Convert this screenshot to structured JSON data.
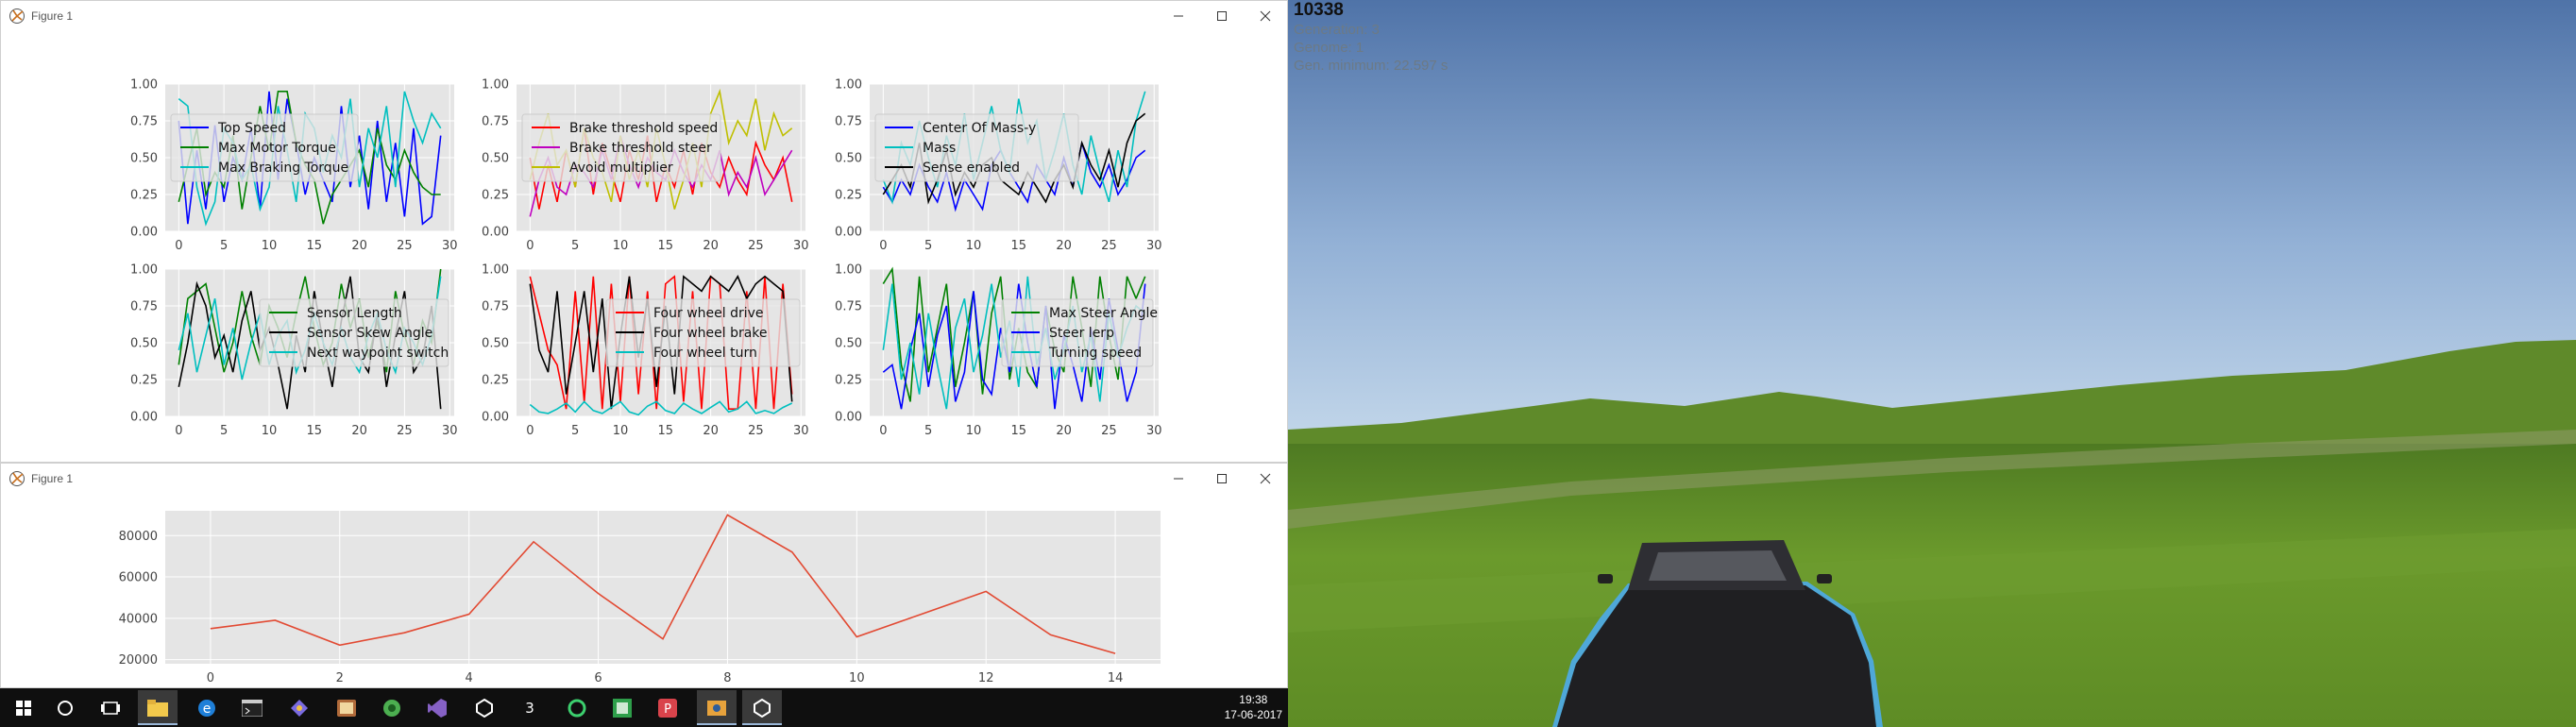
{
  "figure_windows": [
    {
      "title": "Figure 1"
    },
    {
      "title": "Figure 1"
    }
  ],
  "taskbar": {
    "icons": [
      "windows-start-icon",
      "cortana-search-icon",
      "task-view-icon",
      "file-explorer-icon",
      "edge-icon",
      "terminal-icon",
      "game-tool-icon",
      "media-icon",
      "record-icon",
      "visual-studio-icon",
      "unity-icon",
      "code-editor-icon",
      "refresh-app-icon",
      "spreadsheet-icon",
      "presentation-icon",
      "python-figure-icon",
      "unity-active-icon"
    ],
    "time": "19:38",
    "date": "17-06-2017"
  },
  "game": {
    "score": "10338",
    "generation": "Generation: 3",
    "genome": "Genome: 1",
    "best": "Gen. minimum: 22.597 s"
  },
  "chart_data": [
    {
      "type": "line",
      "x": [
        0,
        1,
        2,
        3,
        4,
        5,
        6,
        7,
        8,
        9,
        10,
        11,
        12,
        13,
        14,
        15,
        16,
        17,
        18,
        19,
        20,
        21,
        22,
        23,
        24,
        25,
        26,
        27,
        28,
        29
      ],
      "xlim": [
        -1.5,
        30.5
      ],
      "ylim": [
        0,
        1
      ],
      "legend": "upper-left",
      "series": [
        {
          "name": "Top Speed",
          "color": "#0000ff",
          "values": [
            0.75,
            0.05,
            0.55,
            0.15,
            0.72,
            0.2,
            0.5,
            0.35,
            0.7,
            0.15,
            0.95,
            0.35,
            0.9,
            0.6,
            0.25,
            0.5,
            0.35,
            0.2,
            0.85,
            0.3,
            0.65,
            0.15,
            0.75,
            0.2,
            0.6,
            0.1,
            0.7,
            0.05,
            0.1,
            0.65
          ]
        },
        {
          "name": "Max Motor Torque",
          "color": "#008000",
          "values": [
            0.2,
            0.45,
            0.7,
            0.25,
            0.4,
            0.3,
            0.65,
            0.15,
            0.5,
            0.85,
            0.55,
            0.95,
            0.95,
            0.6,
            0.45,
            0.35,
            0.05,
            0.25,
            0.35,
            0.45,
            0.55,
            0.3,
            0.7,
            0.45,
            0.35,
            0.55,
            0.4,
            0.3,
            0.25,
            0.25
          ]
        },
        {
          "name": "Max Braking Torque",
          "color": "#00bfbf",
          "values": [
            0.9,
            0.85,
            0.3,
            0.05,
            0.2,
            0.7,
            0.6,
            0.35,
            0.45,
            0.15,
            0.3,
            0.85,
            0.55,
            0.2,
            0.8,
            0.7,
            0.4,
            0.65,
            0.5,
            0.9,
            0.3,
            0.7,
            0.5,
            0.85,
            0.3,
            0.95,
            0.75,
            0.6,
            0.8,
            0.7
          ]
        }
      ]
    },
    {
      "type": "line",
      "x": [
        0,
        1,
        2,
        3,
        4,
        5,
        6,
        7,
        8,
        9,
        10,
        11,
        12,
        13,
        14,
        15,
        16,
        17,
        18,
        19,
        20,
        21,
        22,
        23,
        24,
        25,
        26,
        27,
        28,
        29
      ],
      "xlim": [
        -1.5,
        30.5
      ],
      "ylim": [
        0,
        1
      ],
      "legend": "upper-left",
      "series": [
        {
          "name": "Brake threshold speed",
          "color": "#ff0000",
          "values": [
            0.5,
            0.15,
            0.45,
            0.2,
            0.55,
            0.3,
            0.7,
            0.25,
            0.6,
            0.4,
            0.2,
            0.55,
            0.35,
            0.65,
            0.2,
            0.45,
            0.3,
            0.55,
            0.25,
            0.6,
            0.4,
            0.3,
            0.5,
            0.35,
            0.25,
            0.6,
            0.45,
            0.35,
            0.5,
            0.2
          ]
        },
        {
          "name": "Brake threshold steer",
          "color": "#bf00bf",
          "values": [
            0.1,
            0.35,
            0.5,
            0.3,
            0.25,
            0.45,
            0.4,
            0.3,
            0.55,
            0.35,
            0.65,
            0.45,
            0.3,
            0.5,
            0.4,
            0.35,
            0.55,
            0.4,
            0.3,
            0.45,
            0.35,
            0.55,
            0.25,
            0.4,
            0.3,
            0.5,
            0.25,
            0.35,
            0.45,
            0.55
          ]
        },
        {
          "name": "Avoid multiplier",
          "color": "#bfbf00",
          "values": [
            0.35,
            0.6,
            0.8,
            0.45,
            0.55,
            0.3,
            0.7,
            0.5,
            0.4,
            0.2,
            0.65,
            0.35,
            0.55,
            0.3,
            0.7,
            0.45,
            0.15,
            0.35,
            0.6,
            0.3,
            0.8,
            0.95,
            0.6,
            0.75,
            0.65,
            0.9,
            0.55,
            0.8,
            0.65,
            0.7
          ]
        }
      ]
    },
    {
      "type": "line",
      "x": [
        0,
        1,
        2,
        3,
        4,
        5,
        6,
        7,
        8,
        9,
        10,
        11,
        12,
        13,
        14,
        15,
        16,
        17,
        18,
        19,
        20,
        21,
        22,
        23,
        24,
        25,
        26,
        27,
        28,
        29
      ],
      "xlim": [
        -1.5,
        30.5
      ],
      "ylim": [
        0,
        1
      ],
      "legend": "upper-left",
      "series": [
        {
          "name": "Center Of Mass-y",
          "color": "#0000ff",
          "values": [
            0.3,
            0.2,
            0.35,
            0.25,
            0.45,
            0.3,
            0.2,
            0.4,
            0.15,
            0.35,
            0.25,
            0.15,
            0.45,
            0.55,
            0.4,
            0.3,
            0.2,
            0.45,
            0.35,
            0.25,
            0.5,
            0.3,
            0.6,
            0.4,
            0.3,
            0.45,
            0.25,
            0.35,
            0.5,
            0.55
          ]
        },
        {
          "name": "Mass",
          "color": "#00bfbf",
          "values": [
            0.35,
            0.2,
            0.6,
            0.45,
            0.75,
            0.5,
            0.3,
            0.65,
            0.45,
            0.8,
            0.35,
            0.6,
            0.85,
            0.55,
            0.4,
            0.9,
            0.6,
            0.75,
            0.35,
            0.55,
            0.8,
            0.45,
            0.25,
            0.65,
            0.4,
            0.2,
            0.55,
            0.3,
            0.75,
            0.95
          ]
        },
        {
          "name": "Sense enabled",
          "color": "#000000",
          "values": [
            0.25,
            0.35,
            0.45,
            0.3,
            0.6,
            0.2,
            0.35,
            0.55,
            0.25,
            0.4,
            0.3,
            0.45,
            0.5,
            0.35,
            0.3,
            0.25,
            0.4,
            0.3,
            0.2,
            0.35,
            0.45,
            0.3,
            0.6,
            0.45,
            0.35,
            0.55,
            0.3,
            0.6,
            0.75,
            0.8
          ]
        }
      ]
    },
    {
      "type": "line",
      "x": [
        0,
        1,
        2,
        3,
        4,
        5,
        6,
        7,
        8,
        9,
        10,
        11,
        12,
        13,
        14,
        15,
        16,
        17,
        18,
        19,
        20,
        21,
        22,
        23,
        24,
        25,
        26,
        27,
        28,
        29
      ],
      "xlim": [
        -1.5,
        30.5
      ],
      "ylim": [
        0,
        1
      ],
      "legend": "upper-right",
      "series": [
        {
          "name": "Sensor Length",
          "color": "#008000",
          "values": [
            0.35,
            0.8,
            0.85,
            0.9,
            0.6,
            0.3,
            0.5,
            0.85,
            0.55,
            0.35,
            0.75,
            0.6,
            0.4,
            0.7,
            0.95,
            0.6,
            0.35,
            0.5,
            0.9,
            0.6,
            0.8,
            0.4,
            0.65,
            0.3,
            0.85,
            0.55,
            0.35,
            0.65,
            0.5,
            1.0
          ]
        },
        {
          "name": "Sensor Skew Angle",
          "color": "#000000",
          "values": [
            0.2,
            0.5,
            0.9,
            0.75,
            0.4,
            0.55,
            0.3,
            0.65,
            0.85,
            0.45,
            0.6,
            0.35,
            0.05,
            0.55,
            0.3,
            0.85,
            0.5,
            0.2,
            0.65,
            0.95,
            0.4,
            0.3,
            0.7,
            0.2,
            0.55,
            0.85,
            0.3,
            0.4,
            0.75,
            0.05
          ]
        },
        {
          "name": "Next waypoint switch",
          "color": "#00bfbf",
          "values": [
            0.45,
            0.7,
            0.3,
            0.55,
            0.8,
            0.35,
            0.6,
            0.25,
            0.5,
            0.7,
            0.35,
            0.55,
            0.65,
            0.3,
            0.45,
            0.7,
            0.5,
            0.35,
            0.6,
            0.4,
            0.3,
            0.55,
            0.7,
            0.45,
            0.3,
            0.6,
            0.5,
            0.35,
            0.55,
            0.95
          ]
        }
      ]
    },
    {
      "type": "line",
      "x": [
        0,
        1,
        2,
        3,
        4,
        5,
        6,
        7,
        8,
        9,
        10,
        11,
        12,
        13,
        14,
        15,
        16,
        17,
        18,
        19,
        20,
        21,
        22,
        23,
        24,
        25,
        26,
        27,
        28,
        29
      ],
      "xlim": [
        -1.5,
        30.5
      ],
      "ylim": [
        0,
        1
      ],
      "legend": "upper-right",
      "series": [
        {
          "name": "Four wheel drive",
          "color": "#ff0000",
          "values": [
            0.95,
            0.7,
            0.45,
            0.35,
            0.05,
            0.85,
            0.1,
            0.95,
            0.05,
            0.9,
            0.1,
            0.95,
            0.15,
            0.85,
            0.05,
            0.9,
            0.95,
            0.1,
            0.85,
            0.05,
            0.95,
            0.9,
            0.05,
            0.05,
            0.85,
            0.05,
            0.95,
            0.05,
            0.9,
            0.15
          ]
        },
        {
          "name": "Four wheel brake",
          "color": "#000000",
          "values": [
            0.9,
            0.45,
            0.3,
            0.85,
            0.15,
            0.5,
            0.85,
            0.3,
            0.8,
            0.05,
            0.55,
            0.95,
            0.4,
            0.8,
            0.2,
            0.75,
            0.15,
            0.95,
            0.9,
            0.85,
            0.95,
            0.9,
            0.85,
            0.95,
            0.8,
            0.9,
            0.95,
            0.9,
            0.85,
            0.1
          ]
        },
        {
          "name": "Four wheel turn",
          "color": "#00bfbf",
          "values": [
            0.08,
            0.03,
            0.02,
            0.05,
            0.09,
            0.03,
            0.1,
            0.04,
            0.02,
            0.06,
            0.1,
            0.03,
            0.01,
            0.07,
            0.1,
            0.04,
            0.02,
            0.09,
            0.05,
            0.02,
            0.06,
            0.1,
            0.03,
            0.05,
            0.1,
            0.02,
            0.04,
            0.02,
            0.06,
            0.09
          ]
        }
      ]
    },
    {
      "type": "line",
      "x": [
        0,
        1,
        2,
        3,
        4,
        5,
        6,
        7,
        8,
        9,
        10,
        11,
        12,
        13,
        14,
        15,
        16,
        17,
        18,
        19,
        20,
        21,
        22,
        23,
        24,
        25,
        26,
        27,
        28,
        29
      ],
      "xlim": [
        -1.5,
        30.5
      ],
      "ylim": [
        0,
        1
      ],
      "legend": "upper-right",
      "series": [
        {
          "name": "Max Steer Angle",
          "color": "#008000",
          "values": [
            0.9,
            1.0,
            0.35,
            0.1,
            0.95,
            0.3,
            0.6,
            0.9,
            0.2,
            0.5,
            0.85,
            0.15,
            0.7,
            0.95,
            0.25,
            0.6,
            0.3,
            0.2,
            0.75,
            0.45,
            0.3,
            0.95,
            0.6,
            0.2,
            0.95,
            0.55,
            0.25,
            0.95,
            0.8,
            0.95
          ]
        },
        {
          "name": "Steer lerp",
          "color": "#0000ff",
          "values": [
            0.3,
            0.35,
            0.05,
            0.45,
            0.7,
            0.2,
            0.55,
            0.75,
            0.1,
            0.3,
            0.85,
            0.25,
            0.15,
            0.6,
            0.3,
            0.9,
            0.5,
            0.2,
            0.75,
            0.05,
            0.55,
            0.35,
            0.1,
            0.6,
            0.25,
            0.8,
            0.45,
            0.1,
            0.3,
            0.9
          ]
        },
        {
          "name": "Turning speed",
          "color": "#00bfbf",
          "values": [
            0.45,
            0.9,
            0.25,
            0.5,
            0.15,
            0.7,
            0.35,
            0.05,
            0.6,
            0.8,
            0.3,
            0.55,
            0.9,
            0.4,
            0.65,
            0.2,
            0.95,
            0.35,
            0.6,
            0.25,
            0.45,
            0.75,
            0.3,
            0.55,
            0.1,
            0.7,
            0.4,
            0.6,
            0.75,
            0.7
          ]
        }
      ]
    },
    {
      "type": "line",
      "x": [
        0,
        1,
        2,
        3,
        4,
        5,
        6,
        7,
        8,
        9,
        10,
        11,
        12,
        13,
        14
      ],
      "xlim": [
        -0.7,
        14.7
      ],
      "ylim": [
        18000,
        92000
      ],
      "yticks": [
        20000,
        40000,
        60000,
        80000
      ],
      "xticks": [
        0,
        2,
        4,
        6,
        8,
        10,
        12,
        14
      ],
      "series": [
        {
          "color": "#e24a33",
          "values": [
            35000,
            39000,
            27000,
            33000,
            42000,
            77000,
            52000,
            30000,
            90000,
            72000,
            31000,
            42000,
            53000,
            32000,
            23000
          ]
        }
      ]
    }
  ],
  "colors": {
    "plot_bg": "#e5e5e5",
    "grid": "#ffffff",
    "sky_top": "#5578ab",
    "sky_bottom": "#b4cde5",
    "grass": "#6f9a2a"
  }
}
